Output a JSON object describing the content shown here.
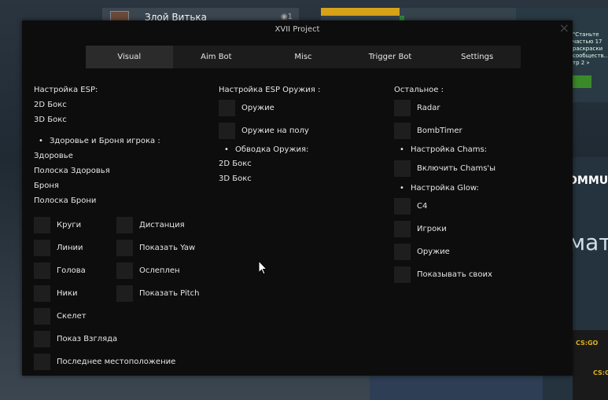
{
  "background": {
    "friend_name": "Злой Витька",
    "friend_count": "1",
    "news_text": "\"Станьте частью 17 раскраски сообществ... тр 2 »",
    "commu_text": "OMMU",
    "mat_text": "мат",
    "csgo_logo": "CS:GO"
  },
  "window": {
    "title": "XVII Project",
    "close_label": "×"
  },
  "tabs": [
    {
      "label": "Visual"
    },
    {
      "label": "Aim Bot"
    },
    {
      "label": "Misc"
    },
    {
      "label": "Trigger Bot"
    },
    {
      "label": "Settings"
    }
  ],
  "esp": {
    "header": "Настройка ESP:",
    "box2d": "2D Бокс",
    "box3d": "3D Бокс",
    "health_header": "Здоровье и Броня игрока :",
    "health": "Здоровье",
    "health_bar": "Полоска Здоровья",
    "armor": "Броня",
    "armor_bar": "Полоска Брони",
    "checkboxes_left": [
      "Круги",
      "Линии",
      "Голова",
      "Ники",
      "Скелет",
      "Показ Взгляда",
      "Последнее местоположение"
    ],
    "checkboxes_right": [
      "Дистанция",
      "Показать Yaw",
      "Ослеплен",
      "Показать Pitch"
    ]
  },
  "weapons": {
    "header": "Настройка ESP Оружия :",
    "checkboxes": [
      "Оружие",
      "Оружие на полу"
    ],
    "outline_header": "Обводка Оружия:",
    "box2d": "2D Бокс",
    "box3d": "3D Бокс"
  },
  "other": {
    "header": "Остальное :",
    "checkboxes_top": [
      "Radar",
      "BombTimer"
    ],
    "chams_header": "Настройка Chams:",
    "chams_checkbox": "Включить Chams'ы",
    "glow_header": "Настройка Glow:",
    "glow_checkboxes": [
      "C4",
      "Игроки",
      "Оружие",
      "Показывать своих"
    ]
  },
  "colors": {
    "menu_bg": "#0d0d0d",
    "tab_bg": "#1c1c1c",
    "tab_active": "#2b2b2b",
    "checkbox": "#1e1e1e"
  }
}
